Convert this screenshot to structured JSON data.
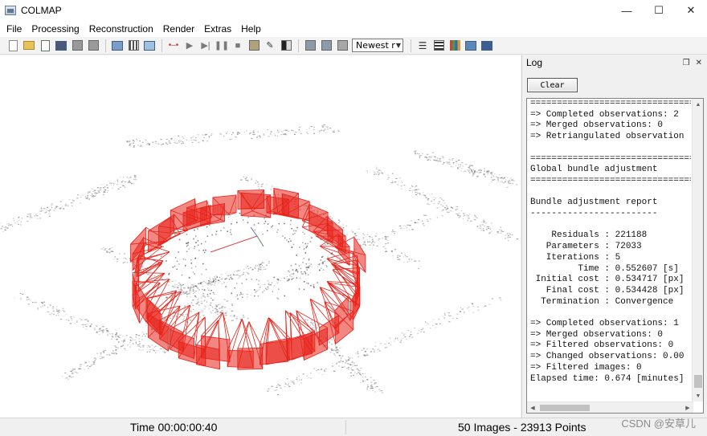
{
  "window": {
    "title": "COLMAP",
    "minimize_glyph": "—",
    "maximize_glyph": "☐",
    "close_glyph": "✕"
  },
  "menu": {
    "items": [
      "File",
      "Processing",
      "Reconstruction",
      "Render",
      "Extras",
      "Help"
    ]
  },
  "toolbar": {
    "icons": [
      "new-project-icon",
      "open-project-icon",
      "edit-project-icon",
      "save-project-icon",
      "import-icon",
      "export-icon",
      "feature-extraction-icon",
      "feature-matching-icon",
      "database-icon",
      "play-icon",
      "step-icon",
      "pause-icon",
      "reset-icon",
      "options-icon",
      "bundle-adjustment-icon",
      "dense-icon",
      "render-icon",
      "render-options-icon",
      "grab-image-icon",
      "grab-movie-icon",
      "log-icon",
      "match-matrix-icon",
      "reconstruction-stats-icon",
      "database-management-icon",
      "settings-icon"
    ],
    "reconstruction_select": "Newest r"
  },
  "log": {
    "title": "Log",
    "clear_label": "Clear",
    "lines": [
      "================================",
      "=> Completed observations: 2",
      "=> Merged observations: 0",
      "=> Retriangulated observation",
      "",
      "================================",
      "Global bundle adjustment",
      "================================",
      "",
      "Bundle adjustment report",
      "------------------------",
      "",
      "    Residuals : 221188",
      "   Parameters : 72033",
      "   Iterations : 5",
      "         Time : 0.552607 [s]",
      " Initial cost : 0.534717 [px]",
      "   Final cost : 0.534428 [px]",
      "  Termination : Convergence",
      "",
      "=> Completed observations: 1",
      "=> Merged observations: 0",
      "=> Filtered observations: 0",
      "=> Changed observations: 0.00",
      "=> Filtered images: 0",
      "Elapsed time: 0.674 [minutes]"
    ]
  },
  "status": {
    "time": "Time 00:00:00:40",
    "counts": "50 Images - 23913 Points"
  },
  "watermark": "CSDN @安草儿",
  "colors": {
    "camera_red": "#e8221a",
    "point_grey": "#7a7a7a",
    "background": "#ffffff"
  }
}
